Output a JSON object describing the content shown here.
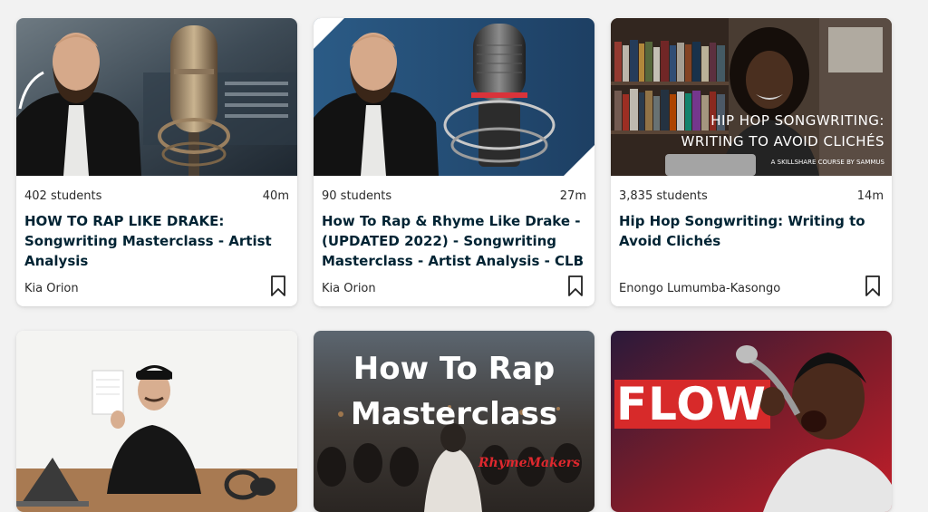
{
  "courses": [
    {
      "students": "402 students",
      "duration": "40m",
      "title": "HOW TO RAP LIKE DRAKE: Songwriting Masterclass - Artist Analysis",
      "teacher": "Kia Orion"
    },
    {
      "students": "90 students",
      "duration": "27m",
      "title": "How To Rap & Rhyme Like Drake - (UPDATED 2022) - Songwriting Masterclass - Artist Analysis - CLB",
      "teacher": "Kia Orion"
    },
    {
      "students": "3,835 students",
      "duration": "14m",
      "title": "Hip Hop Songwriting: Writing to Avoid Clichés",
      "teacher": "Enongo Lumumba-Kasongo",
      "thumb_line1": "HIP HOP SONGWRITING:",
      "thumb_line2": "WRITING TO AVOID CLICHÉS",
      "thumb_credit": "A SKILLSHARE COURSE BY SAMMUS"
    }
  ],
  "row2": [
    {},
    {
      "thumb_line1": "How To Rap",
      "thumb_line2": "Masterclass",
      "thumb_logo": "RhymeMakers"
    },
    {
      "thumb_text": "FLOW"
    }
  ]
}
